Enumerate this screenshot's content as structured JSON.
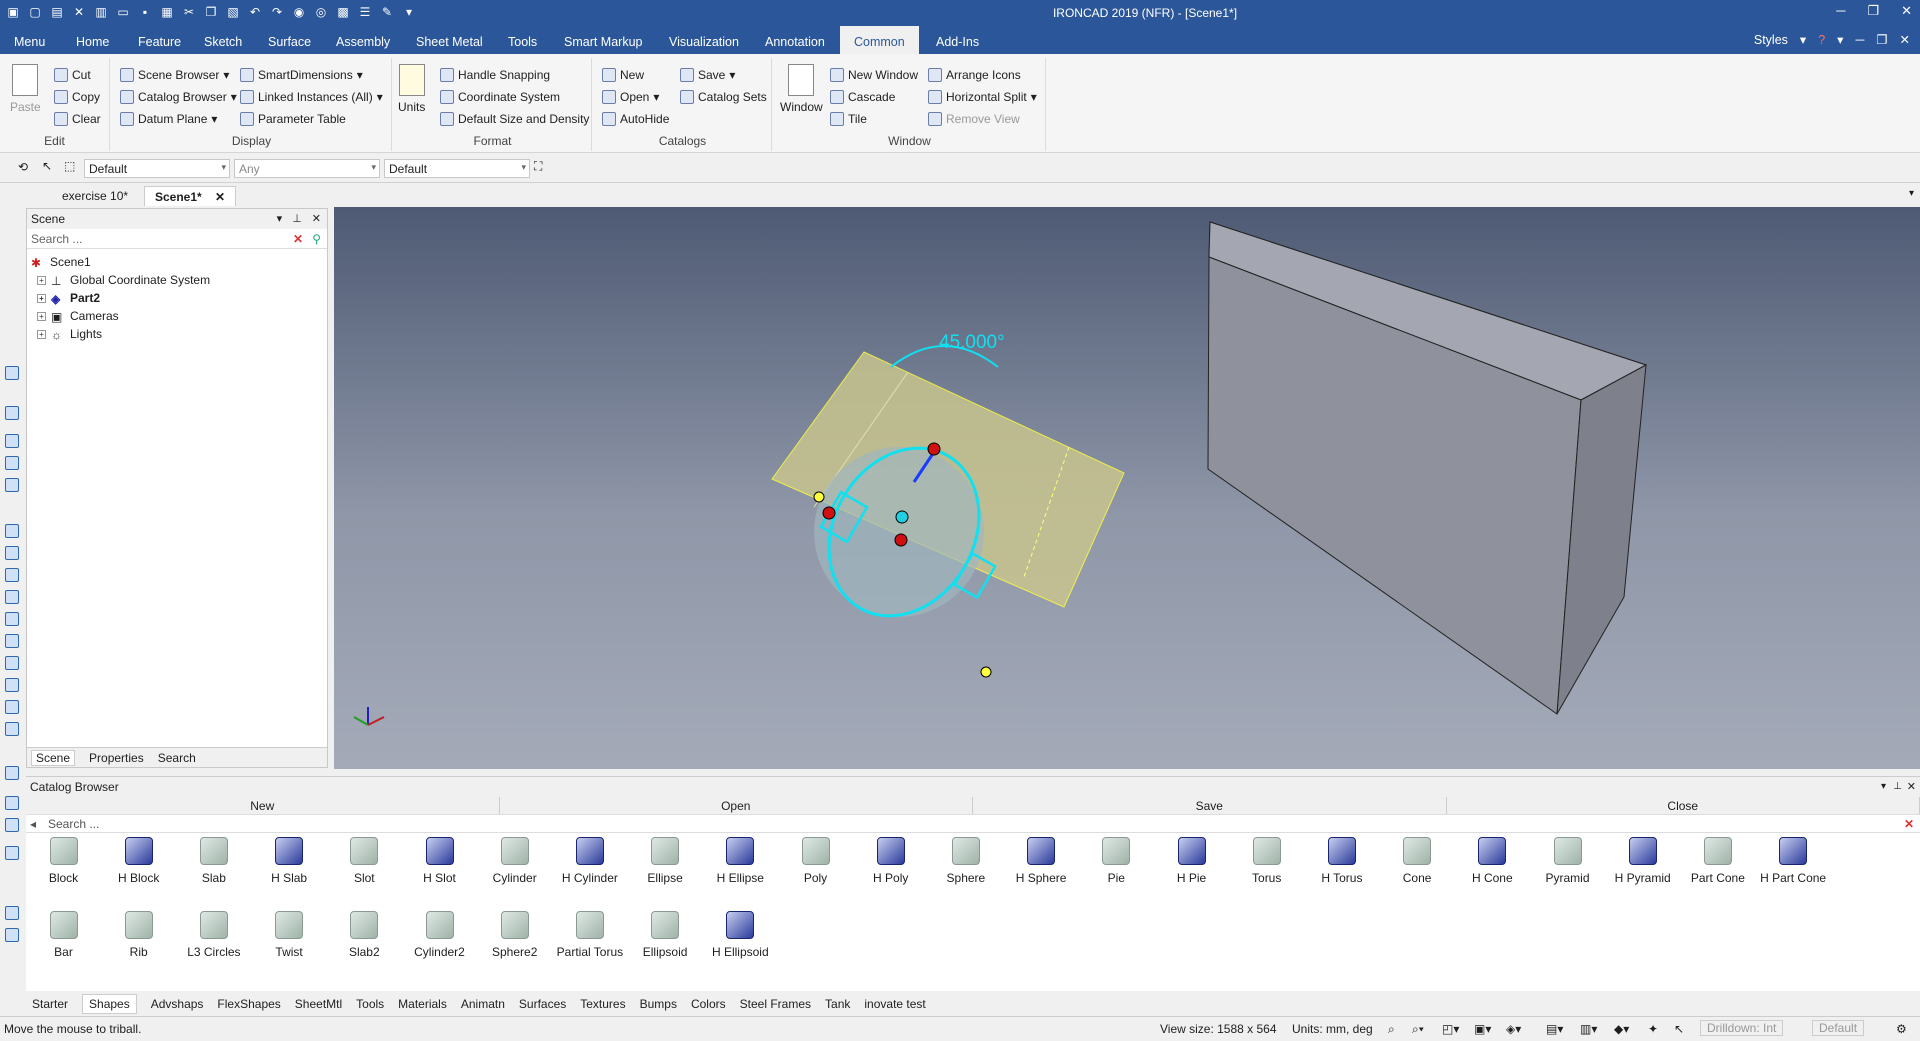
{
  "app": {
    "title": "IRONCAD 2019 (NFR) - [Scene1*]"
  },
  "menu": {
    "tabs": [
      "Menu",
      "Home",
      "Feature",
      "Sketch",
      "Surface",
      "Assembly",
      "Sheet Metal",
      "Tools",
      "Smart Markup",
      "Visualization",
      "Annotation",
      "Common",
      "Add-Ins"
    ],
    "active": "Common",
    "styles_label": "Styles"
  },
  "ribbon": {
    "edit": {
      "paste": "Paste",
      "cut": "Cut",
      "copy": "Copy",
      "clear": "Clear",
      "label": "Edit"
    },
    "display": {
      "scene_browser": "Scene Browser",
      "catalog_browser": "Catalog Browser",
      "datum_plane": "Datum Plane",
      "smart_dimensions": "SmartDimensions",
      "linked_instances": "Linked Instances (All)",
      "parameter_table": "Parameter Table",
      "label": "Display"
    },
    "format": {
      "units": "Units",
      "handle_snapping": "Handle Snapping",
      "coordinate_system": "Coordinate System",
      "default_size": "Default Size and Density",
      "label": "Format"
    },
    "catalogs": {
      "new": "New",
      "open": "Open",
      "autohide": "AutoHide",
      "save": "Save",
      "catalog_sets": "Catalog Sets",
      "label": "Catalogs"
    },
    "window": {
      "window": "Window",
      "new_window": "New Window",
      "cascade": "Cascade",
      "tile": "Tile",
      "arrange_icons": "Arrange Icons",
      "horizontal_split": "Horizontal Split",
      "remove_view": "Remove View",
      "label": "Window"
    }
  },
  "toolbar": {
    "combo1": "Default",
    "combo2": "Any",
    "combo3": "Default"
  },
  "doc_tabs": [
    "exercise 10*",
    "Scene1*"
  ],
  "scene": {
    "title": "Scene",
    "search_placeholder": "Search ...",
    "tree": [
      "Scene1",
      "Global Coordinate System",
      "Part2",
      "Cameras",
      "Lights"
    ],
    "tabs": [
      "Scene",
      "Properties",
      "Search"
    ]
  },
  "viewport": {
    "angle_label": "45.000°"
  },
  "catalog": {
    "title": "Catalog Browser",
    "buttons": [
      "New",
      "Open",
      "Save",
      "Close"
    ],
    "search_placeholder": "Search ...",
    "row1": [
      "Block",
      "H Block",
      "Slab",
      "H Slab",
      "Slot",
      "H Slot",
      "Cylinder",
      "H Cylinder",
      "Ellipse",
      "H Ellipse",
      "Poly",
      "H Poly",
      "Sphere",
      "H Sphere",
      "Pie",
      "H Pie",
      "Torus",
      "H Torus",
      "Cone",
      "H Cone",
      "Pyramid",
      "H Pyramid",
      "Part Cone",
      "H Part Cone"
    ],
    "row2": [
      "Bar",
      "Rib",
      "L3 Circles",
      "Twist",
      "Slab2",
      "Cylinder2",
      "Sphere2",
      "Partial Torus",
      "Ellipsoid",
      "H Ellipsoid"
    ],
    "tabs": [
      "Starter",
      "Shapes",
      "Advshaps",
      "FlexShapes",
      "SheetMtl",
      "Tools",
      "Materials",
      "Animatn",
      "Surfaces",
      "Textures",
      "Bumps",
      "Colors",
      "Steel Frames",
      "Tank",
      "inovate test"
    ],
    "active_tab": "Shapes"
  },
  "status": {
    "message": "Move the mouse to triball.",
    "view_size": "View size: 1588 x  564",
    "units": "Units: mm, deg",
    "drilldown": "Drilldown: Int",
    "default": "Default"
  }
}
